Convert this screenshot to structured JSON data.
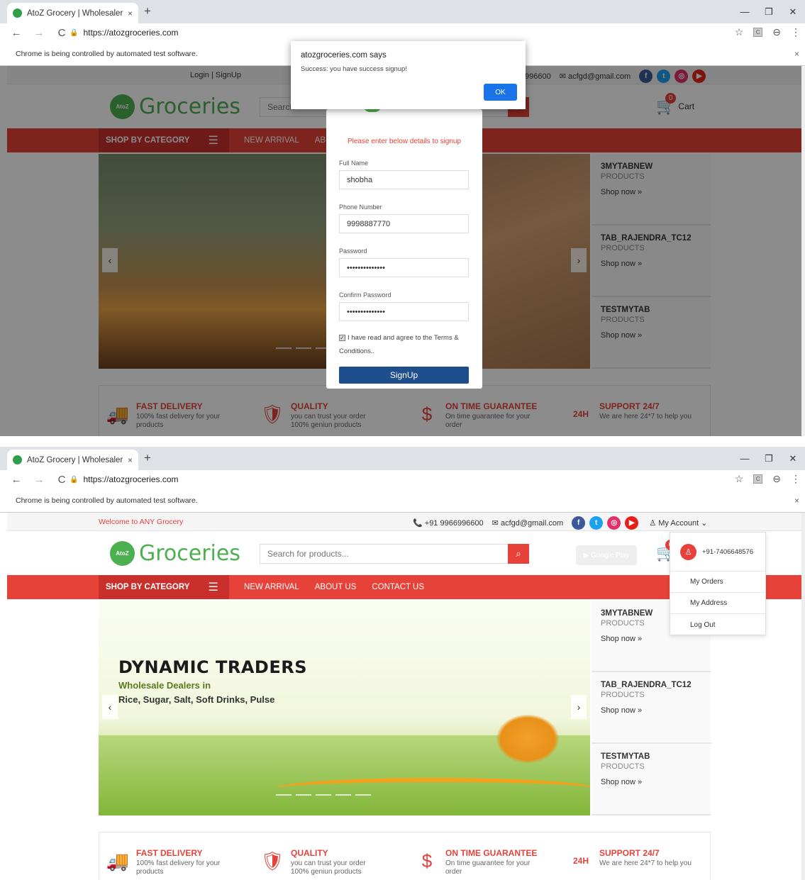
{
  "browser": {
    "tab_title": "AtoZ Grocery | Wholesaler in Ban",
    "tab_close": "×",
    "new_tab": "+",
    "url": "https://atozgroceries.com",
    "infobar_text": "Chrome is being controlled by automated test software.",
    "infobar_close": "×",
    "controls": {
      "minimize": "—",
      "maximize": "❐",
      "close": "✕"
    },
    "back": "←",
    "forward": "→",
    "reload": "C",
    "lock": "🔒",
    "star": "☆",
    "account": "⊖",
    "menu": "⋮",
    "ext": "C"
  },
  "header": {
    "login_link": "Login | SignUp",
    "welcome": "Welcome to ANY Grocery",
    "phone": "+91 9966996600",
    "phone_partial": "996600",
    "email": "acfgd@gmail.com",
    "my_account": "My Account",
    "social": {
      "fb": "f",
      "tw": "t",
      "ig": "◎",
      "yt": "▶"
    },
    "logo_badge": "AtoZ",
    "logo_text": "Groceries",
    "search_placeholder": "Search for products...",
    "search_placeholder_partial": "Search",
    "search_btn": "⌕",
    "google_play": "▶ Google Play",
    "cart_count": "0",
    "cart_label": "Cart",
    "cart_icon": "🛒"
  },
  "nav": {
    "shop_by_category": "SHOP BY CATEGORY",
    "menu_icon": "☰",
    "links": [
      "NEW ARRIVAL",
      "ABOUT US",
      "CONTACT US"
    ],
    "partial_link": "AB"
  },
  "banner": {
    "title": "DYNAMIC TRADERS",
    "subtitle": "Wholesale Dealers in",
    "subtitle2": "Rice, Sugar, Salt, Soft Drinks, Pulse",
    "prev": "‹",
    "next": "›"
  },
  "side_products": [
    {
      "name": "3MYTABNEW",
      "sub": "PRODUCTS",
      "shop": "Shop now »"
    },
    {
      "name": "TAB_RAJENDRA_TC12",
      "sub": "PRODUCTS",
      "shop": "Shop now »"
    },
    {
      "name": "TESTMYTAB",
      "sub": "PRODUCTS",
      "shop": "Shop now »"
    }
  ],
  "features": [
    {
      "title": "FAST DELIVERY",
      "desc": "100% fast delivery for your products",
      "icon": "🚚"
    },
    {
      "title": "QUALITY",
      "desc": "you can trust your order 100% geniun products",
      "icon": "🛡"
    },
    {
      "title": "ON TIME GUARANTEE",
      "desc": "On time guarantee for your order",
      "icon": "$"
    },
    {
      "title": "SUPPORT 24/7",
      "desc": "We are here 24*7 to help you",
      "icon": "24H"
    }
  ],
  "signup_modal": {
    "note": "Please enter below details to signup",
    "full_name_label": "Full Name",
    "full_name_value": "shobha",
    "phone_label": "Phone Number",
    "phone_value": "9998887770",
    "password_label": "Password",
    "password_value": "••••••••••••••",
    "confirm_label": "Confirm Password",
    "confirm_value": "••••••••••••••",
    "terms_text": "I have read and agree to the Terms & Conditions..",
    "terms_check": "✓",
    "button": "SignUp"
  },
  "alert": {
    "title": "atozgroceries.com says",
    "message": "Success: you have success signup!",
    "ok": "OK"
  },
  "account_menu": {
    "avatar": "♙",
    "phone": "+91-7406648576",
    "items": [
      "My Orders",
      "My Address",
      "Log Out"
    ]
  }
}
